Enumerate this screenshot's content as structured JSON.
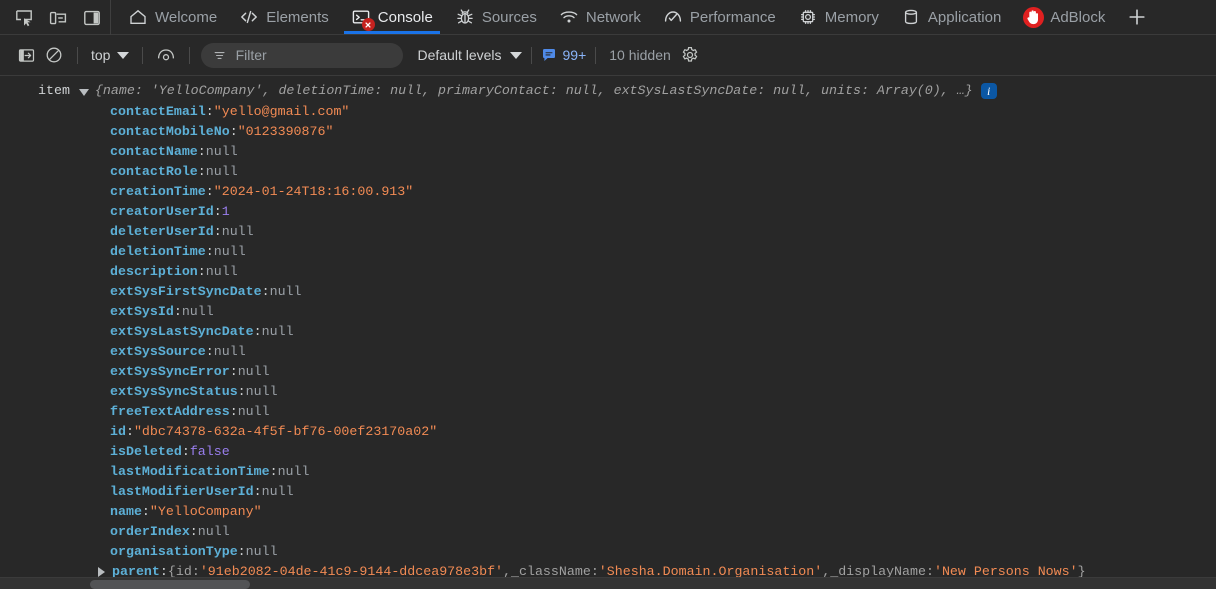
{
  "window": {
    "title": "Chrome DevTools - Console"
  },
  "dock_controls": [
    {
      "name": "inspect-element-icon",
      "label": "Inspect element"
    },
    {
      "name": "device-toolbar-icon",
      "label": "Toggle device toolbar"
    },
    {
      "name": "dock-side-icon",
      "label": "Dock side"
    }
  ],
  "tabs": [
    {
      "label": "Welcome",
      "icon": "home-icon",
      "active": false,
      "error_badge": false
    },
    {
      "label": "Elements",
      "icon": "code-icon",
      "active": false,
      "error_badge": false
    },
    {
      "label": "Console",
      "icon": "console-icon",
      "active": true,
      "error_badge": true
    },
    {
      "label": "Sources",
      "icon": "bug-icon",
      "active": false,
      "error_badge": false
    },
    {
      "label": "Network",
      "icon": "wifi-icon",
      "active": false,
      "error_badge": false
    },
    {
      "label": "Performance",
      "icon": "gauge-icon",
      "active": false,
      "error_badge": false
    },
    {
      "label": "Memory",
      "icon": "chip-icon",
      "active": false,
      "error_badge": false
    },
    {
      "label": "Application",
      "icon": "database-icon",
      "active": false,
      "error_badge": false
    },
    {
      "label": "AdBlock",
      "icon": "adblock-hand-icon",
      "active": false,
      "error_badge": false
    }
  ],
  "new_tab_label": "+",
  "toolbar": {
    "sidebar_toggle": "console-sidebar-toggle",
    "clear_label": "Clear console",
    "context": "top",
    "eye_label": "Live expressions",
    "filter_placeholder": "Filter",
    "filter_value": "",
    "levels": "Default levels",
    "message_count": "99+",
    "hidden_count": "10 hidden",
    "settings_label": "Console settings"
  },
  "console": {
    "entry_label": "item",
    "preview": "{name: 'YelloCompany', deletionTime: null, primaryContact: null, extSysLastSyncDate: null, units: Array(0), …}",
    "info_icon": "i",
    "properties": [
      {
        "key": "contactEmail",
        "value": "\"yello@gmail.com\"",
        "type": "string"
      },
      {
        "key": "contactMobileNo",
        "value": "\"0123390876\"",
        "type": "string"
      },
      {
        "key": "contactName",
        "value": "null",
        "type": "null"
      },
      {
        "key": "contactRole",
        "value": "null",
        "type": "null"
      },
      {
        "key": "creationTime",
        "value": "\"2024-01-24T18:16:00.913\"",
        "type": "string"
      },
      {
        "key": "creatorUserId",
        "value": "1",
        "type": "number"
      },
      {
        "key": "deleterUserId",
        "value": "null",
        "type": "null"
      },
      {
        "key": "deletionTime",
        "value": "null",
        "type": "null"
      },
      {
        "key": "description",
        "value": "null",
        "type": "null"
      },
      {
        "key": "extSysFirstSyncDate",
        "value": "null",
        "type": "null"
      },
      {
        "key": "extSysId",
        "value": "null",
        "type": "null"
      },
      {
        "key": "extSysLastSyncDate",
        "value": "null",
        "type": "null"
      },
      {
        "key": "extSysSource",
        "value": "null",
        "type": "null"
      },
      {
        "key": "extSysSyncError",
        "value": "null",
        "type": "null"
      },
      {
        "key": "extSysSyncStatus",
        "value": "null",
        "type": "null"
      },
      {
        "key": "freeTextAddress",
        "value": "null",
        "type": "null"
      },
      {
        "key": "id",
        "value": "\"dbc74378-632a-4f5f-bf76-00ef23170a02\"",
        "type": "string"
      },
      {
        "key": "isDeleted",
        "value": "false",
        "type": "boolean"
      },
      {
        "key": "lastModificationTime",
        "value": "null",
        "type": "null"
      },
      {
        "key": "lastModifierUserId",
        "value": "null",
        "type": "null"
      },
      {
        "key": "name",
        "value": "\"YelloCompany\"",
        "type": "string"
      },
      {
        "key": "orderIndex",
        "value": "null",
        "type": "null"
      },
      {
        "key": "organisationType",
        "value": "null",
        "type": "null"
      }
    ],
    "parent_row": {
      "key": "parent",
      "open_brace": "{",
      "close_brace": "}",
      "fields": [
        {
          "key": "id",
          "value": "'91eb2082-04de-41c9-9144-ddcea978e3bf'"
        },
        {
          "key": "_className",
          "value": "'Shesha.Domain.Organisation'"
        },
        {
          "key": "_displayName",
          "value": "'New Persons Nows'"
        }
      ]
    }
  },
  "colors": {
    "background": "#282828",
    "accent_tab_underline": "#1a73e8",
    "property_name": "#5db0d7",
    "string_value": "#f28b54",
    "null_value": "#9aa0a6",
    "number_value": "#9a7fef",
    "error_badge": "#c5221f",
    "adblock_red": "#e02020",
    "info_chip": "#0b57a4",
    "message_count": "#8ab4f8"
  }
}
